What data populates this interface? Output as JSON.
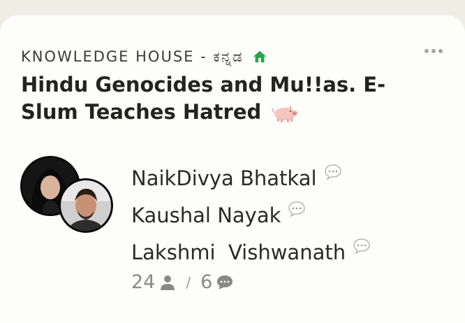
{
  "room": {
    "club_name": "KNOWLEDGE HOUSE - ಕನ್ನಡ",
    "title": "Hindu Genocides and Mu!!as. E-Slum Teaches Hatred",
    "title_emoji": "pig-icon",
    "speakers": [
      {
        "name": "NaikDivya Bhatkal",
        "icon": "chat-bubble-icon"
      },
      {
        "name": "Kaushal Nayak",
        "icon": "chat-bubble-icon"
      },
      {
        "name": "Lakshmi  Vishwanath",
        "icon": "chat-bubble-icon"
      }
    ],
    "listener_count": "24",
    "speaker_count": "6",
    "separator": "/"
  },
  "colors": {
    "background": "#efeee4",
    "card": "#fdfdfb",
    "club_house_icon": "#27a745",
    "stats_text": "#8a8a84"
  }
}
